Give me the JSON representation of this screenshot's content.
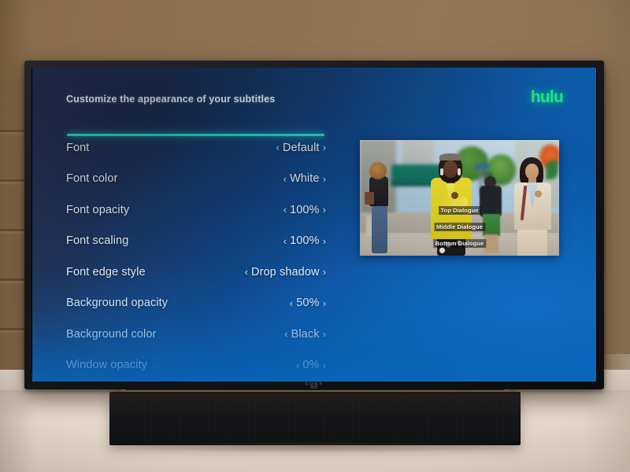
{
  "scene": {
    "device_brand": "SONY",
    "wall_color": "#8d7052",
    "console_color": "#e6dccf"
  },
  "screen": {
    "app_name": "hulu",
    "accent_color": "#1ce783",
    "highlight_color": "#24e6d0",
    "background_from": "#1e2a4e",
    "background_to": "#0a63b4",
    "header": {
      "title": "Customize the appearance of your subtitles"
    },
    "settings": [
      {
        "label": "Font",
        "value": "Default",
        "selected": true
      },
      {
        "label": "Font color",
        "value": "White",
        "selected": false
      },
      {
        "label": "Font opacity",
        "value": "100%",
        "selected": false
      },
      {
        "label": "Font scaling",
        "value": "100%",
        "selected": false
      },
      {
        "label": "Font edge style",
        "value": "Drop shadow",
        "selected": false
      },
      {
        "label": "Background opacity",
        "value": "50%",
        "selected": false
      },
      {
        "label": "Background color",
        "value": "Black",
        "selected": false
      },
      {
        "label": "Window opacity",
        "value": "0%",
        "selected": false
      }
    ],
    "chevrons": {
      "prev": "‹",
      "next": "›"
    },
    "preview": {
      "subtitle_top": "Top Dialogue",
      "subtitle_middle": "Middle Dialogue",
      "subtitle_bottom": "Bottom Dialogue"
    }
  }
}
